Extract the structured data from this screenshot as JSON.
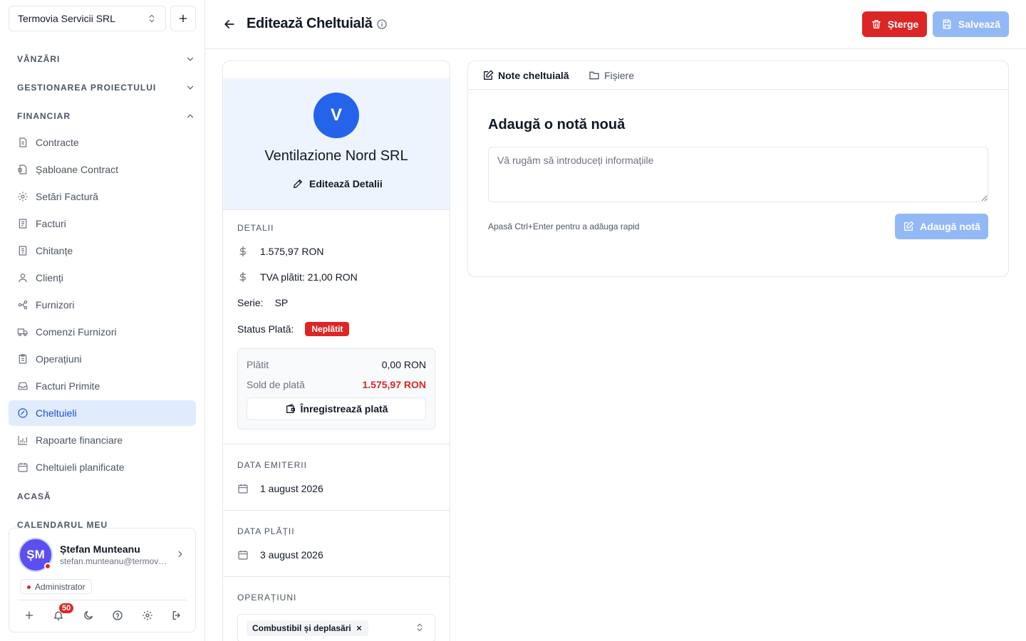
{
  "company": {
    "name": "Termovia Servicii SRL"
  },
  "sidebar": {
    "sections": {
      "sales": "VÂNZĂRI",
      "projects": "GESTIONAREA PROIECTULUI",
      "financial": "FINANCIAR",
      "home": "ACASĂ",
      "calendar": "CALENDARUL MEU"
    },
    "items": [
      {
        "label": "Contracte",
        "icon": "document-icon"
      },
      {
        "label": "Șabloane Contract",
        "icon": "template-icon"
      },
      {
        "label": "Setări Factură",
        "icon": "gear-icon"
      },
      {
        "label": "Facturi",
        "icon": "invoice-icon"
      },
      {
        "label": "Chitanțe",
        "icon": "receipt-icon"
      },
      {
        "label": "Clienți",
        "icon": "user-icon"
      },
      {
        "label": "Furnizori",
        "icon": "network-icon"
      },
      {
        "label": "Comenzi Furnizori",
        "icon": "truck-icon"
      },
      {
        "label": "Operațiuni",
        "icon": "clipboard-icon"
      },
      {
        "label": "Facturi Primite",
        "icon": "inbox-icon"
      },
      {
        "label": "Cheltuieli",
        "icon": "expense-icon",
        "active": true
      },
      {
        "label": "Rapoarte financiare",
        "icon": "bar-chart-icon"
      },
      {
        "label": "Cheltuieli planificate",
        "icon": "calendar-icon"
      }
    ]
  },
  "user": {
    "initials": "ȘM",
    "name": "Ștefan Munteanu",
    "email": "stefan.munteanu@termovia.ro",
    "role": "Administrator",
    "notifications": "50"
  },
  "header": {
    "title": "Editează Cheltuială",
    "delete_label": "Șterge",
    "save_label": "Salvează"
  },
  "expense": {
    "vendor_initial": "V",
    "vendor_name": "Ventilazione Nord SRL",
    "edit_details_label": "Editează Detalii",
    "details_label": "DETALII",
    "amount": "1.575,97 RON",
    "vat": "TVA plătit: 21,00 RON",
    "series_label": "Serie:",
    "series_value": "SP",
    "status_label": "Status Plată:",
    "status_value": "Neplătit",
    "paid_label": "Plătit",
    "paid_value": "0,00 RON",
    "balance_label": "Sold de plată",
    "balance_value": "1.575,97 RON",
    "record_payment_label": "Înregistrează plată",
    "issue_date_label": "DATA EMITERII",
    "issue_date": "1 august 2026",
    "payment_date_label": "DATA PLĂȚII",
    "payment_date": "3 august 2026",
    "operations_label": "OPERAȚIUNI",
    "operation_chip": "Combustibil și deplasări"
  },
  "notes": {
    "tab_notes": "Note cheltuială",
    "tab_files": "Fișiere",
    "title": "Adaugă o notă nouă",
    "placeholder": "Vă rugăm să introduceți informațiile",
    "hint": "Apasă Ctrl+Enter pentru a adăuga rapid",
    "add_label": "Adaugă notă"
  },
  "colors": {
    "accent": "#2563eb",
    "danger": "#dc2626",
    "active_bg": "#e0ecfd",
    "disabled_blue": "#93b8f6"
  }
}
